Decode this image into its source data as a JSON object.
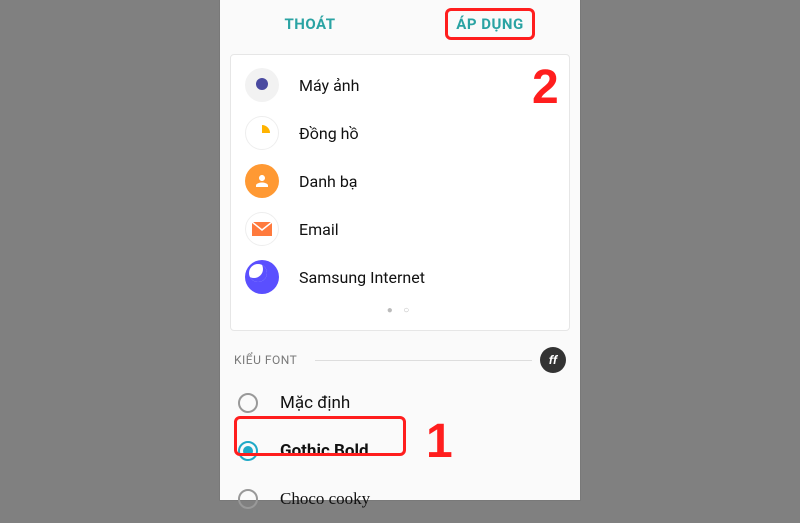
{
  "actions": {
    "exit": "THOÁT",
    "apply": "ÁP DỤNG"
  },
  "preview": {
    "apps": [
      {
        "label": "Máy ảnh",
        "icon": "camera"
      },
      {
        "label": "Đồng hồ",
        "icon": "clock"
      },
      {
        "label": "Danh bạ",
        "icon": "contacts"
      },
      {
        "label": "Email",
        "icon": "email"
      },
      {
        "label": "Samsung Internet",
        "icon": "internet"
      }
    ]
  },
  "font_section": {
    "title": "KIỂU FONT",
    "badge": "ff",
    "options": [
      {
        "label": "Mặc định",
        "selected": false
      },
      {
        "label": "Gothic Bold",
        "selected": true
      },
      {
        "label": "Choco cooky",
        "selected": false
      }
    ]
  },
  "markers": {
    "one": "1",
    "two": "2"
  }
}
